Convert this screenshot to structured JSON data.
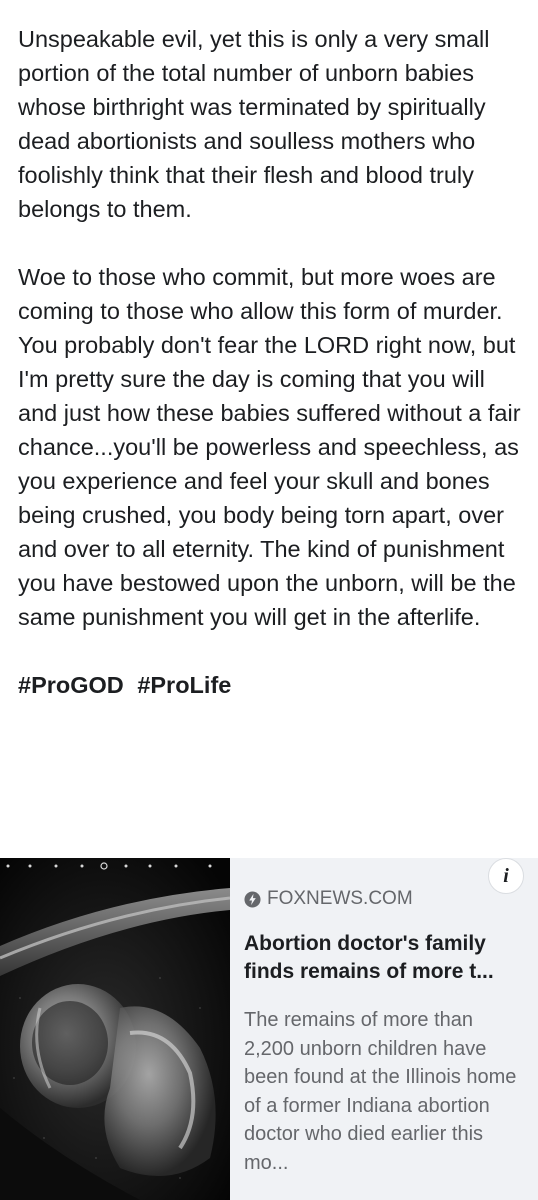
{
  "post": {
    "paragraphs": [
      "Unspeakable evil, yet this is only a very small portion of the total number of unborn babies whose birthright was terminated by spiritually dead abortionists and soulless mothers who foolishly think that their flesh and blood truly belongs to them.",
      "Woe to those who commit, but more woes are coming to those who allow this form of murder. You probably don't fear the LORD right now, but I'm pretty sure the day is coming that you will and just how these babies suffered without a fair chance...you'll be powerless and speechless, as you experience and feel your skull and bones being crushed, you body being torn apart, over and over to all eternity. The kind of punishment you have bestowed upon the unborn, will be the same punishment you will get in the afterlife."
    ],
    "hashtags": [
      "#ProGOD",
      "#ProLife"
    ]
  },
  "link_card": {
    "info_label": "i",
    "source_icon": "lightning-bolt-icon",
    "source": "FOXNEWS.COM",
    "headline": "Abortion doctor's family finds remains of more t...",
    "description": "The remains of more than 2,200 unborn children have been found at the Illinois home of a former Indiana abortion doctor who died earlier this mo..."
  },
  "colors": {
    "text_primary": "#1c1e21",
    "text_secondary": "#65676b",
    "card_background": "#f0f2f5"
  }
}
